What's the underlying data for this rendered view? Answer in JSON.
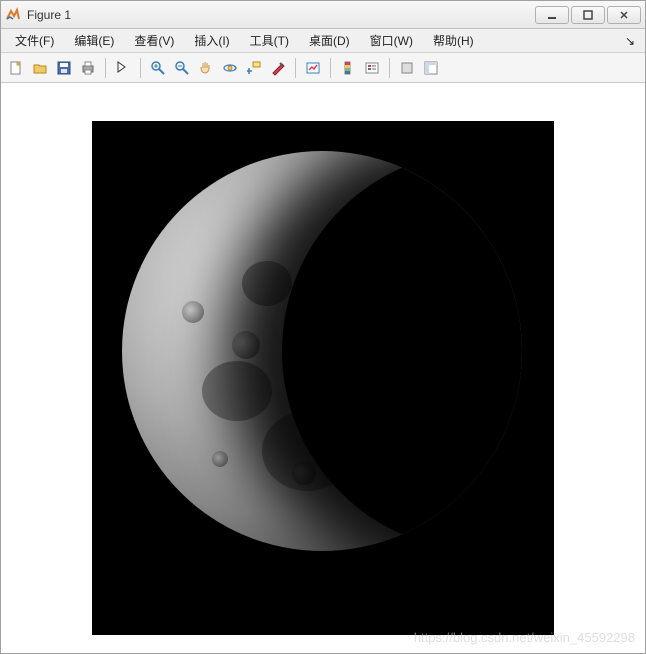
{
  "window": {
    "title": "Figure 1"
  },
  "menubar": {
    "items": [
      {
        "label": "文件(F)"
      },
      {
        "label": "编辑(E)"
      },
      {
        "label": "查看(V)"
      },
      {
        "label": "插入(I)"
      },
      {
        "label": "工具(T)"
      },
      {
        "label": "桌面(D)"
      },
      {
        "label": "窗口(W)"
      },
      {
        "label": "帮助(H)"
      }
    ]
  },
  "toolbar": {
    "icons": {
      "new": "new-file-icon",
      "open": "open-folder-icon",
      "save": "save-icon",
      "print": "print-icon",
      "pointer": "pointer-icon",
      "zoomin": "zoom-in-icon",
      "zoomout": "zoom-out-icon",
      "pan": "pan-hand-icon",
      "rotate": "rotate3d-icon",
      "datatip": "data-cursor-icon",
      "brush": "brush-icon",
      "link": "link-icon",
      "colorbar": "colorbar-icon",
      "legend": "legend-icon",
      "hide": "hide-plot-tools-icon",
      "show": "show-plot-tools-icon"
    }
  },
  "figure": {
    "content_description": "grayscale moon image (gibbous phase)"
  },
  "watermark": {
    "text": "https://blog.csdn.net/weixin_45592298"
  }
}
